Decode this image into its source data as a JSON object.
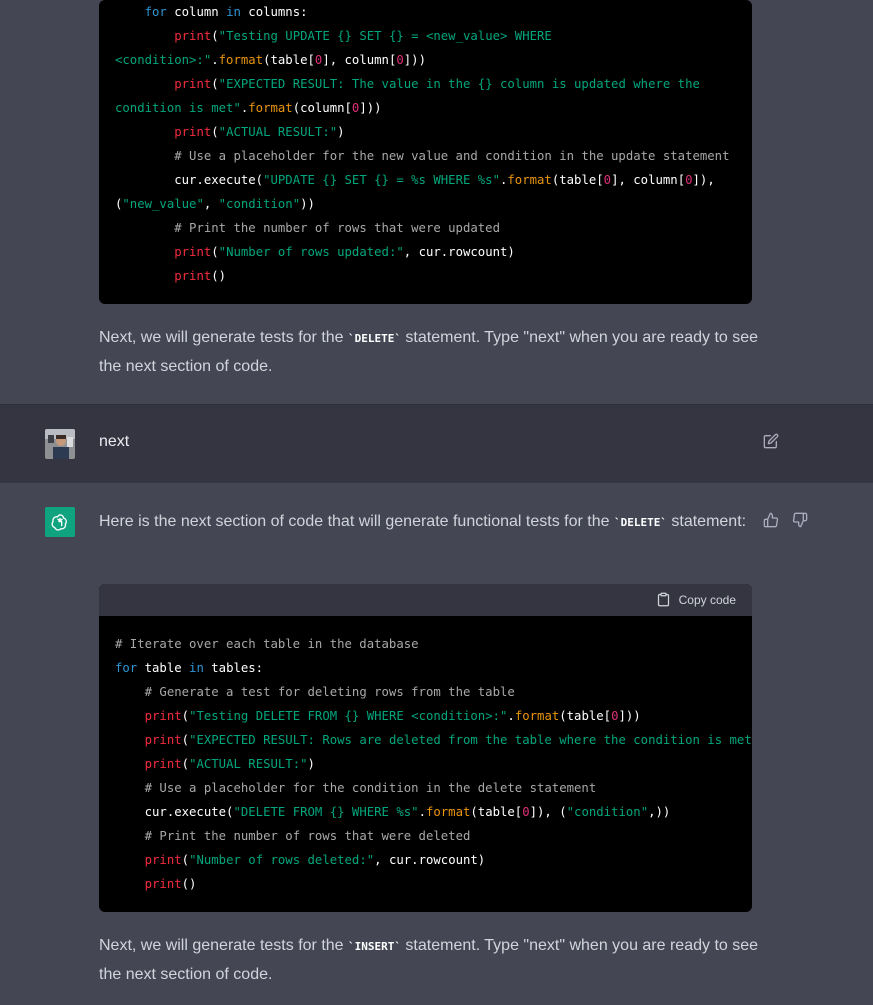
{
  "colors": {
    "ai_bg": "#444654",
    "user_bg": "#343541",
    "code_bg": "#000000",
    "accent": "#10a37f"
  },
  "top_code": {
    "lines": [
      [
        {
          "t": "    "
        },
        {
          "t": "for",
          "c": "kw"
        },
        {
          "t": " column "
        },
        {
          "t": "in",
          "c": "kw"
        },
        {
          "t": " columns:"
        }
      ],
      [
        {
          "t": "        "
        },
        {
          "t": "print",
          "c": "fn"
        },
        {
          "t": "("
        },
        {
          "t": "\"Testing UPDATE {} SET {} = <new_value> WHERE",
          "c": "str"
        }
      ],
      [
        {
          "t": "<condition>:\"",
          "c": "str"
        },
        {
          "t": "."
        },
        {
          "t": "format",
          "c": "meth"
        },
        {
          "t": "(table["
        },
        {
          "t": "0",
          "c": "num"
        },
        {
          "t": "], column["
        },
        {
          "t": "0",
          "c": "num"
        },
        {
          "t": "]))"
        }
      ],
      [
        {
          "t": "        "
        },
        {
          "t": "print",
          "c": "fn"
        },
        {
          "t": "("
        },
        {
          "t": "\"EXPECTED RESULT: The value in the {} column is updated where the",
          "c": "str"
        }
      ],
      [
        {
          "t": "condition is met\"",
          "c": "str"
        },
        {
          "t": "."
        },
        {
          "t": "format",
          "c": "meth"
        },
        {
          "t": "(column["
        },
        {
          "t": "0",
          "c": "num"
        },
        {
          "t": "]))"
        }
      ],
      [
        {
          "t": "        "
        },
        {
          "t": "print",
          "c": "fn"
        },
        {
          "t": "("
        },
        {
          "t": "\"ACTUAL RESULT:\"",
          "c": "str"
        },
        {
          "t": ")"
        }
      ],
      [
        {
          "t": "        "
        },
        {
          "t": "# Use a placeholder for the new value and condition in the update statement",
          "c": "com"
        }
      ],
      [
        {
          "t": "        cur.execute("
        },
        {
          "t": "\"UPDATE {} SET {} = %s WHERE %s\"",
          "c": "str"
        },
        {
          "t": "."
        },
        {
          "t": "format",
          "c": "meth"
        },
        {
          "t": "(table["
        },
        {
          "t": "0",
          "c": "num"
        },
        {
          "t": "], column["
        },
        {
          "t": "0",
          "c": "num"
        },
        {
          "t": "]),"
        }
      ],
      [
        {
          "t": "("
        },
        {
          "t": "\"new_value\"",
          "c": "str"
        },
        {
          "t": ", "
        },
        {
          "t": "\"condition\"",
          "c": "str"
        },
        {
          "t": "))"
        }
      ],
      [
        {
          "t": "        "
        },
        {
          "t": "# Print the number of rows that were updated",
          "c": "com"
        }
      ],
      [
        {
          "t": "        "
        },
        {
          "t": "print",
          "c": "fn"
        },
        {
          "t": "("
        },
        {
          "t": "\"Number of rows updated:\"",
          "c": "str"
        },
        {
          "t": ", cur.rowcount)"
        }
      ],
      [
        {
          "t": "        "
        },
        {
          "t": "print",
          "c": "fn"
        },
        {
          "t": "()"
        }
      ]
    ]
  },
  "msg1": {
    "before": "Next, we will generate tests for the ",
    "code": "`DELETE`",
    "after": " statement. Type \"next\" when you are ready to see the next section of code."
  },
  "user_msg": {
    "text": "next",
    "edit_icon": "edit-icon"
  },
  "reply": {
    "before": "Here is the next section of code that will generate functional tests for the ",
    "code": "`DELETE`",
    "after": " statement:",
    "copy_label": "Copy code",
    "code_lines": [
      [
        {
          "t": "# Iterate over each table in the database",
          "c": "com"
        }
      ],
      [
        {
          "t": "for",
          "c": "kw"
        },
        {
          "t": " table "
        },
        {
          "t": "in",
          "c": "kw"
        },
        {
          "t": " tables:"
        }
      ],
      [
        {
          "t": "    "
        },
        {
          "t": "# Generate a test for deleting rows from the table",
          "c": "com"
        }
      ],
      [
        {
          "t": "    "
        },
        {
          "t": "print",
          "c": "fn"
        },
        {
          "t": "("
        },
        {
          "t": "\"Testing DELETE FROM {} WHERE <condition>:\"",
          "c": "str"
        },
        {
          "t": "."
        },
        {
          "t": "format",
          "c": "meth"
        },
        {
          "t": "(table["
        },
        {
          "t": "0",
          "c": "num"
        },
        {
          "t": "]))"
        }
      ],
      [
        {
          "t": "    "
        },
        {
          "t": "print",
          "c": "fn"
        },
        {
          "t": "("
        },
        {
          "t": "\"EXPECTED RESULT: Rows are deleted from the table where the condition is met\"",
          "c": "str"
        },
        {
          "t": ")"
        }
      ],
      [
        {
          "t": "    "
        },
        {
          "t": "print",
          "c": "fn"
        },
        {
          "t": "("
        },
        {
          "t": "\"ACTUAL RESULT:\"",
          "c": "str"
        },
        {
          "t": ")"
        }
      ],
      [
        {
          "t": "    "
        },
        {
          "t": "# Use a placeholder for the condition in the delete statement",
          "c": "com"
        }
      ],
      [
        {
          "t": "    cur.execute("
        },
        {
          "t": "\"DELETE FROM {} WHERE %s\"",
          "c": "str"
        },
        {
          "t": "."
        },
        {
          "t": "format",
          "c": "meth"
        },
        {
          "t": "(table["
        },
        {
          "t": "0",
          "c": "num"
        },
        {
          "t": "]), ("
        },
        {
          "t": "\"condition\"",
          "c": "str"
        },
        {
          "t": ",))"
        }
      ],
      [
        {
          "t": "    "
        },
        {
          "t": "# Print the number of rows that were deleted",
          "c": "com"
        }
      ],
      [
        {
          "t": "    "
        },
        {
          "t": "print",
          "c": "fn"
        },
        {
          "t": "("
        },
        {
          "t": "\"Number of rows deleted:\"",
          "c": "str"
        },
        {
          "t": ", cur.rowcount)"
        }
      ],
      [
        {
          "t": "    "
        },
        {
          "t": "print",
          "c": "fn"
        },
        {
          "t": "()"
        }
      ]
    ]
  },
  "msg2": {
    "before": "Next, we will generate tests for the ",
    "code": "`INSERT`",
    "after": " statement. Type \"next\" when you are ready to see the next section of code."
  }
}
